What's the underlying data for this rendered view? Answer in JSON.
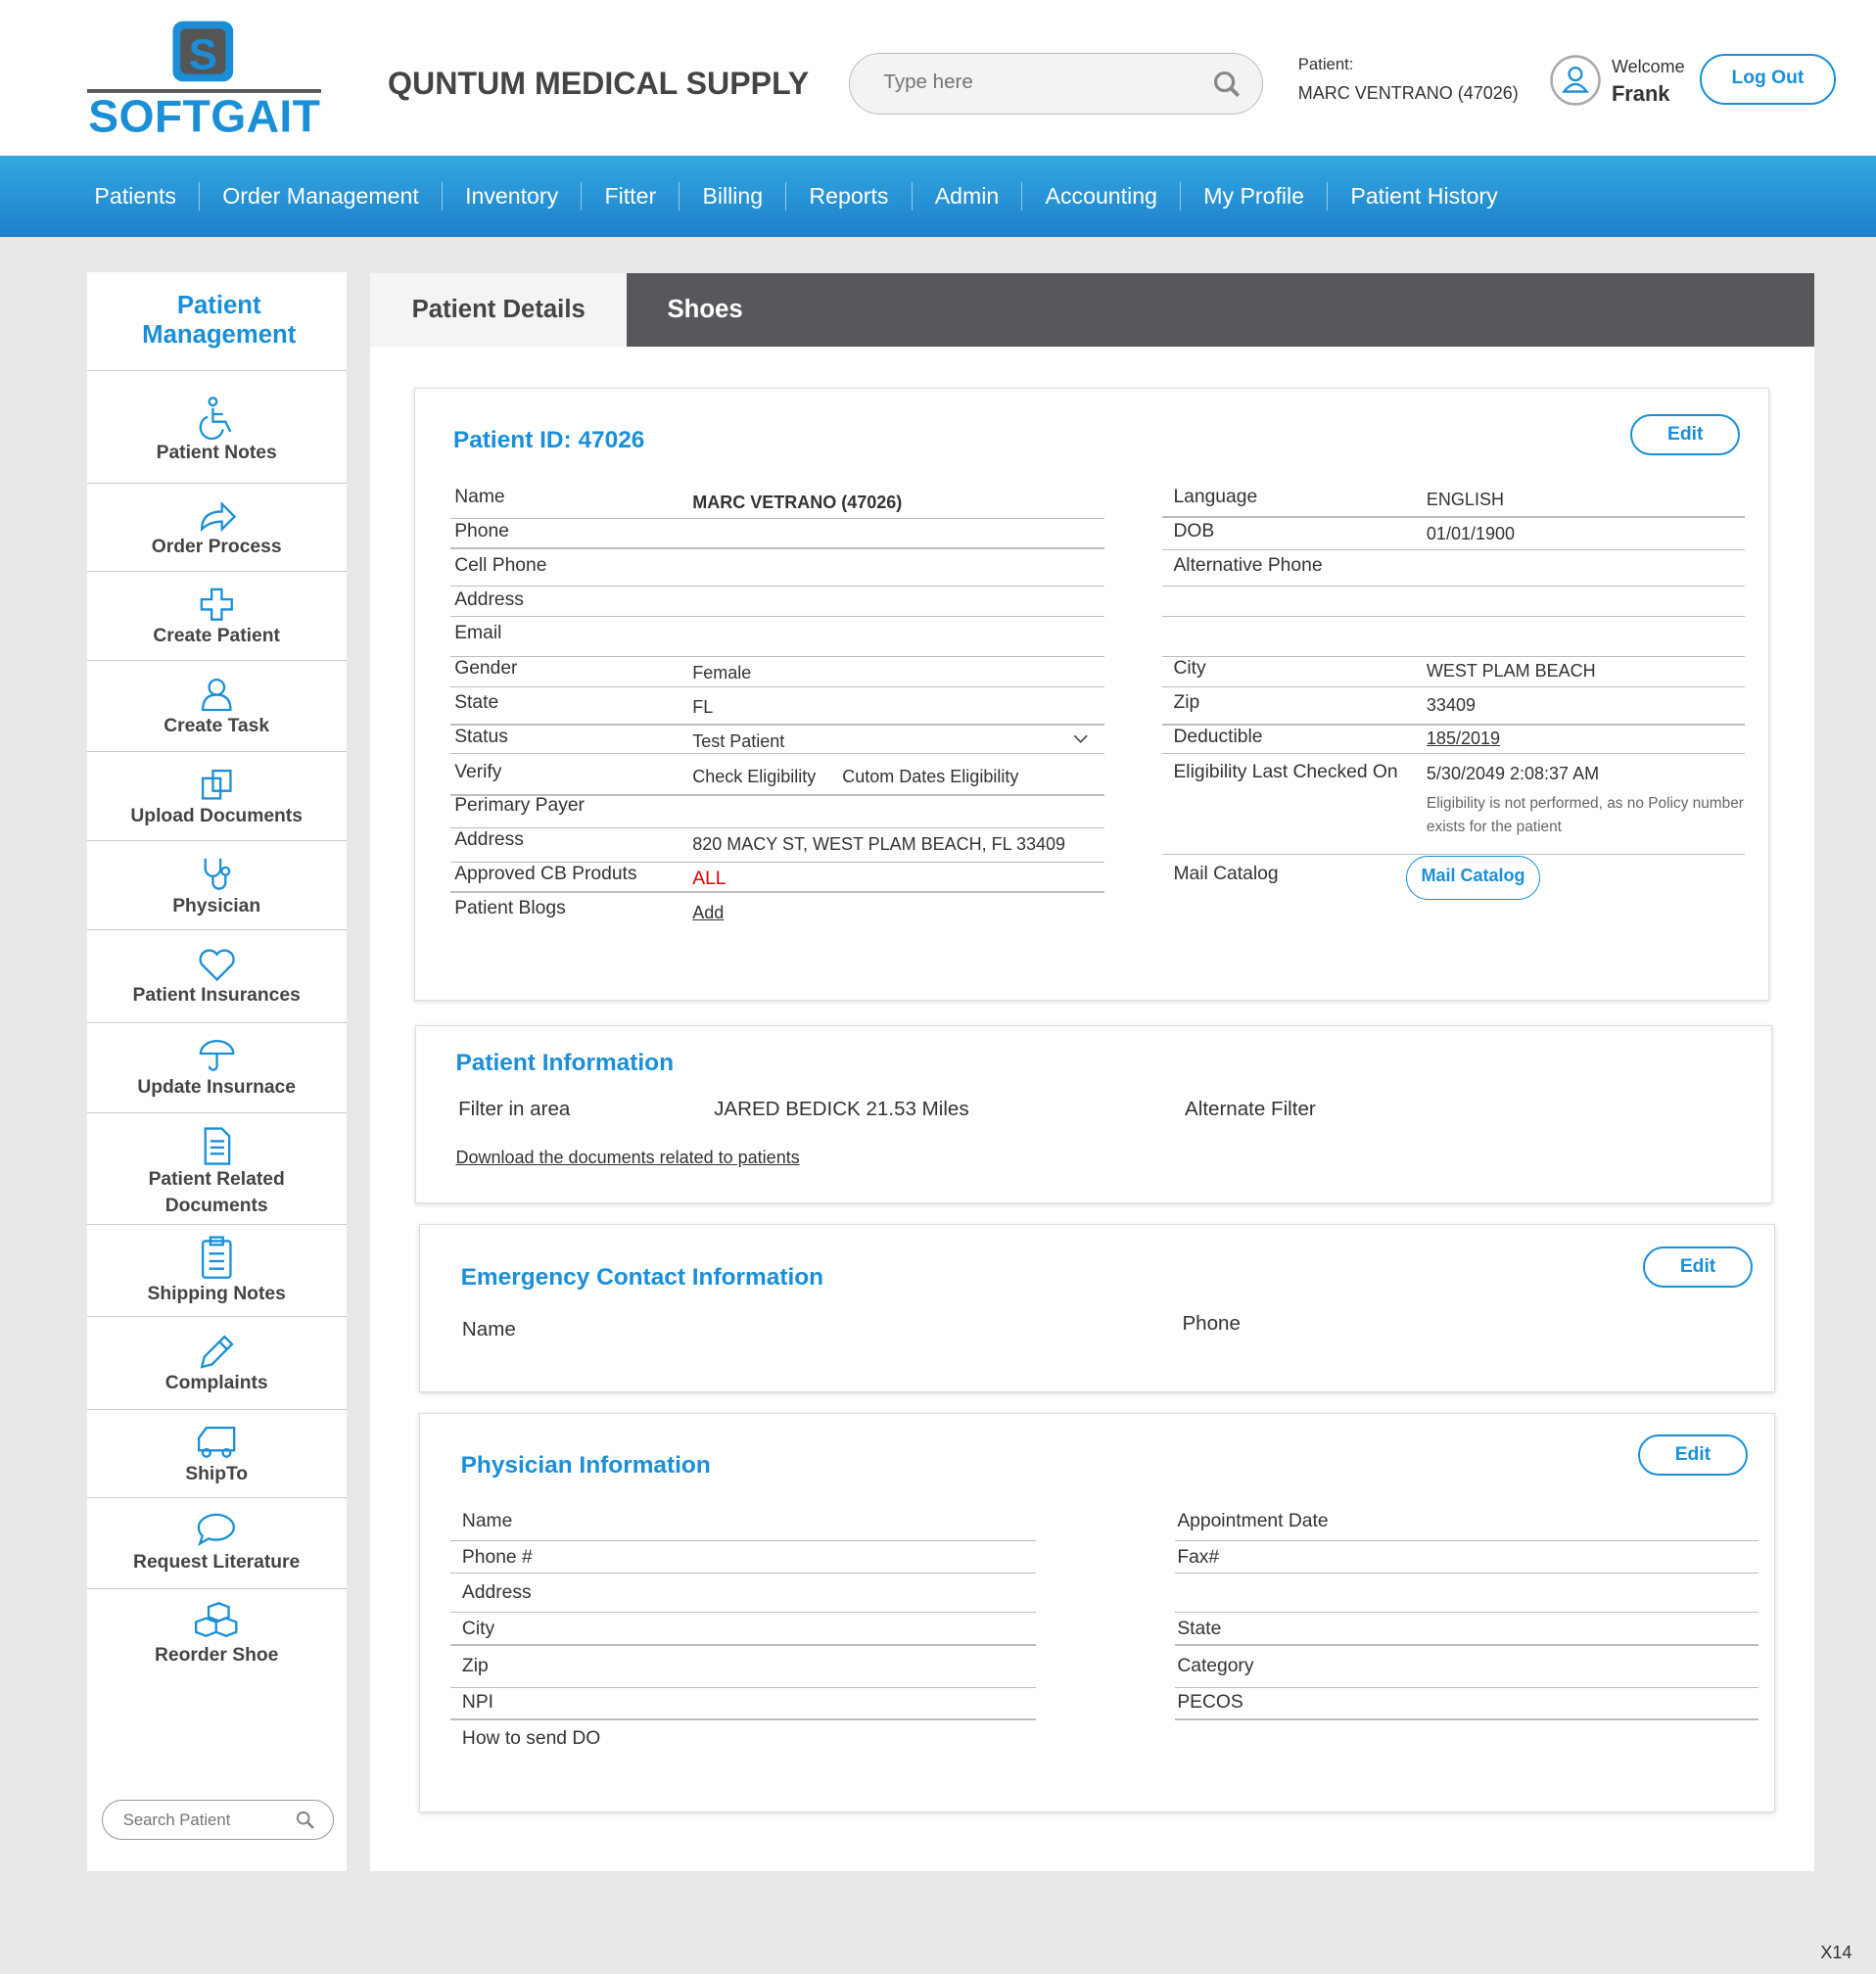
{
  "header": {
    "brand": "SOFTGAIT",
    "title": "QUNTUM MEDICAL SUPPLY",
    "search_placeholder": "Type here",
    "patient_label": "Patient:",
    "patient_name": "MARC VENTRANO (47026)",
    "welcome": "Welcome",
    "user": "Frank",
    "logout": "Log Out"
  },
  "nav": [
    "Patients",
    "Order Management",
    "Inventory",
    "Fitter",
    "Billing",
    "Reports",
    "Admin",
    "Accounting",
    "My Profile",
    "Patient History"
  ],
  "sidebar": {
    "title": "Patient Management",
    "items": [
      "Patient Notes",
      "Order Process",
      "Create Patient",
      "Create Task",
      "Upload Documents",
      "Physician",
      "Patient Insurances",
      "Update Insurnace",
      "Patient Related Documents",
      "Shipping Notes",
      "Complaints",
      "ShipTo",
      "Request Literature",
      "Reorder Shoe"
    ],
    "search_placeholder": "Search Patient"
  },
  "tabs": [
    "Patient Details",
    "Shoes"
  ],
  "patient": {
    "title": "Patient ID: 47026",
    "edit": "Edit",
    "left": [
      [
        "Name",
        "MARC VETRANO (47026)"
      ],
      [
        "Phone",
        ""
      ],
      [
        "Cell Phone",
        ""
      ],
      [
        "Address",
        ""
      ],
      [
        "Email",
        ""
      ],
      [
        "Gender",
        "Female"
      ],
      [
        "State",
        "FL"
      ],
      [
        "Status",
        "Test Patient"
      ],
      [
        "Verify",
        ""
      ],
      [
        "Perimary Payer",
        ""
      ],
      [
        "Address",
        "820 MACY ST, WEST PLAM BEACH, FL 33409"
      ],
      [
        "Approved CB Produts",
        "ALL"
      ],
      [
        "Patient Blogs",
        "Add"
      ]
    ],
    "verify_links": [
      "Check Eligibility",
      "Cutom Dates Eligibility"
    ],
    "right": [
      [
        "Language",
        "ENGLISH"
      ],
      [
        "DOB",
        "01/01/1900"
      ],
      [
        "Alternative Phone",
        ""
      ],
      [
        "City",
        "WEST PLAM BEACH"
      ],
      [
        "Zip",
        "33409"
      ],
      [
        "Deductible",
        "185/2019"
      ],
      [
        "Eligibility Last Checked On",
        "5/30/2049 2:08:37 AM"
      ],
      [
        "Mail Catalog",
        ""
      ]
    ],
    "eligibility_note": "Eligibility is not performed, as no Policy number exists for the patient",
    "mail_catalog_button": "Mail Catalog"
  },
  "info": {
    "title": "Patient Information",
    "filter_label": "Filter in area",
    "filter_value": "JARED BEDICK 21.53 Miles",
    "alt_filter": "Alternate Filter",
    "download": "Download the documents related to patients"
  },
  "emergency": {
    "title": "Emergency Contact Information",
    "edit": "Edit",
    "name": "Name",
    "phone": "Phone"
  },
  "physician": {
    "title": "Physician Information",
    "edit": "Edit",
    "left": [
      "Name",
      "Phone #",
      "Address",
      "City",
      "Zip",
      "NPI",
      "How to send DO"
    ],
    "right": [
      "Appointment Date",
      "Fax#",
      "",
      "State",
      "Category",
      "PECOS"
    ]
  },
  "footer": "X14",
  "colors": {
    "accent": "#1a8fd8",
    "tab_dark": "#58585c",
    "required": "#e00000"
  }
}
